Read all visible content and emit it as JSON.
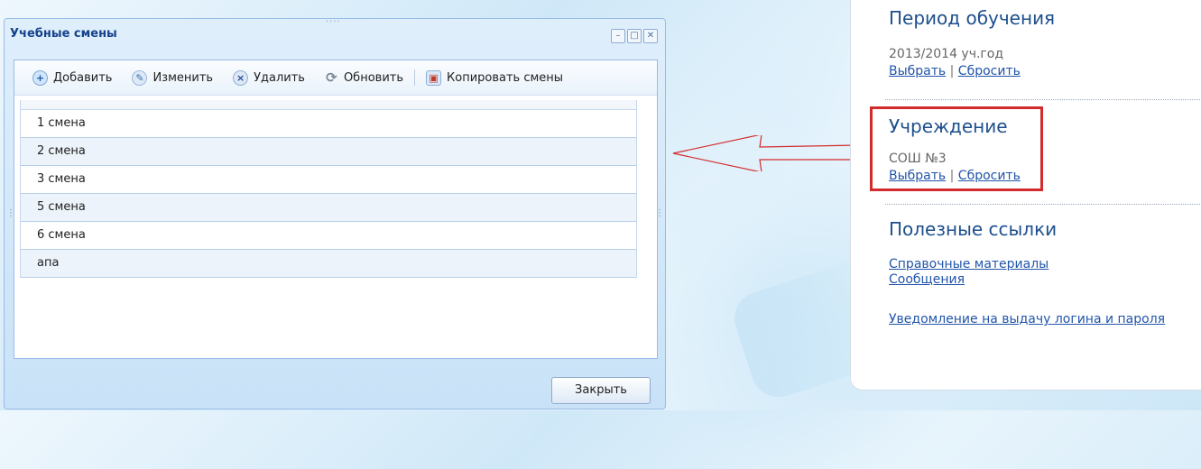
{
  "dialog": {
    "title": "Учебные смены",
    "toolbar": {
      "add": "Добавить",
      "edit": "Изменить",
      "delete": "Удалить",
      "refresh": "Обновить",
      "copy": "Копировать смены"
    },
    "rows": [
      "1 смена",
      "2 смена",
      "3 смена",
      "5 смена",
      "6 смена",
      "апа"
    ],
    "close": "Закрыть"
  },
  "info": {
    "period": {
      "title": "Период обучения",
      "value": "2013/2014 уч.год",
      "select": "Выбрать",
      "reset": "Сбросить"
    },
    "institution": {
      "title": "Учреждение",
      "value": "СОШ №3",
      "select": "Выбрать",
      "reset": "Сбросить"
    },
    "links": {
      "title": "Полезные ссылки",
      "items": [
        "Справочные материалы",
        "Сообщения",
        "Уведомление на выдачу логина и пароля"
      ]
    },
    "separator": "|"
  },
  "colors": {
    "highlight": "#d22b2b",
    "arrow": "#d22b2b",
    "window_title": "#15428b"
  },
  "icons": {
    "add": "plus-icon",
    "edit": "pencil-icon",
    "delete": "x-icon",
    "refresh": "refresh-icon",
    "copy": "copy-icon"
  }
}
